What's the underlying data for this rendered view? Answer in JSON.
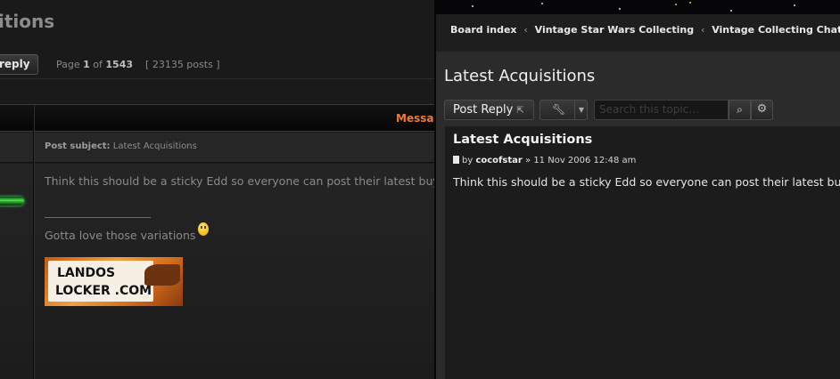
{
  "left_panel": {
    "title_fragment": "itions",
    "reply_fragment": "reply",
    "page_label": "Page",
    "page_current": "1",
    "page_of": "of",
    "page_total": "1543",
    "post_count": "[ 23135 posts ]",
    "header_fragment": "Messag",
    "subject_label": "Post subject:",
    "subject_value": "Latest Acquisitions",
    "post_text": "Think this should be a sticky Edd so everyone can post their latest buys?",
    "signature_text": "Gotta love those variations",
    "banner_line1": "LANDOS",
    "banner_line2": "LOCKER .COM",
    "accent_color": "#f07a31"
  },
  "right_panel": {
    "breadcrumbs": [
      "Board index",
      "Vintage Star Wars Collecting",
      "Vintage Collecting Chat"
    ],
    "breadcrumb_separator": "‹",
    "topic_title": "Latest Acquisitions",
    "post_reply_label": "Post Reply",
    "post_reply_icon": "pencil-arrow-icon",
    "tools_icon": "wrench-icon",
    "tools_caret_icon": "caret-down-icon",
    "search_placeholder": "Search this topic…",
    "search_icon": "magnifier-icon",
    "advanced_search_icon": "gear-icon",
    "post": {
      "title": "Latest Acquisitions",
      "by": "by",
      "author": "cocofstar",
      "date_separator": "»",
      "date": "11 Nov 2006 12:48 am",
      "body": "Think this should be a sticky Edd so everyone can post their latest buys?"
    }
  }
}
